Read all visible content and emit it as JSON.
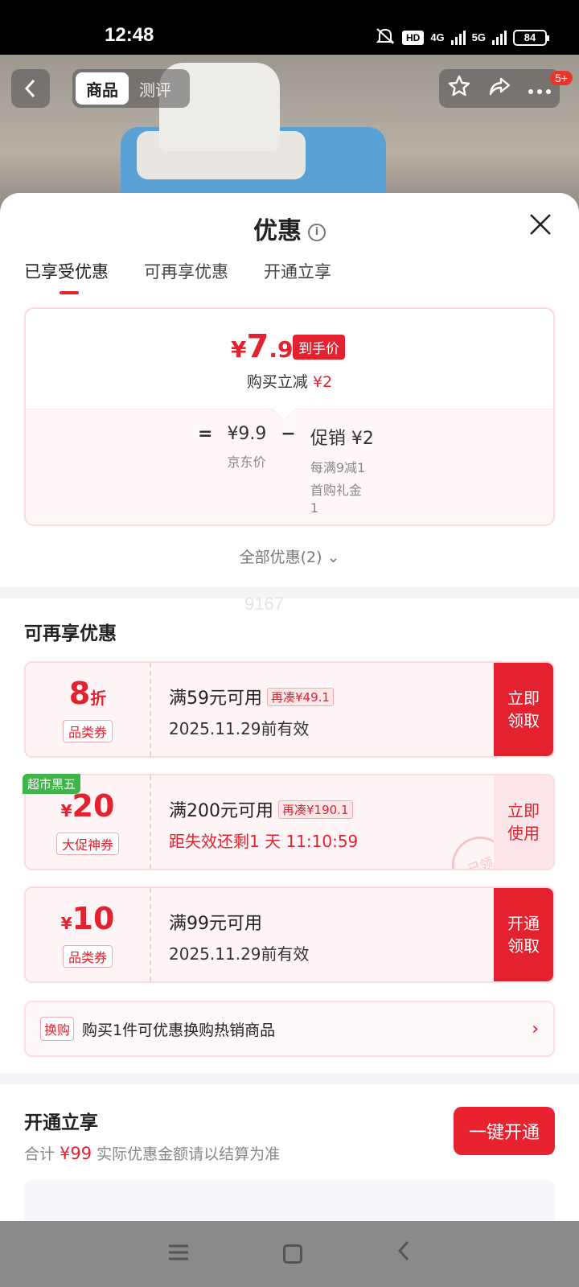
{
  "status_bar": {
    "time": "12:48",
    "net1": "4G",
    "net2": "5G",
    "hd": "HD",
    "battery": "84"
  },
  "header": {
    "tabs": [
      "商品",
      "测评"
    ],
    "badge": "5+"
  },
  "sheet": {
    "title": "优惠",
    "tabs": [
      "已享受优惠",
      "可再享优惠",
      "开通立享"
    ],
    "price_card": {
      "currency": "¥",
      "final_int": "7",
      "final_dec": ".9",
      "arrive_label": "到手价",
      "reduce_label": "购买立减",
      "reduce_value": "¥2",
      "eq": "=",
      "jd_price": "¥9.9",
      "jd_label": "京东价",
      "minus": "−",
      "promo": "促销 ¥2",
      "promo_sub1": "每满9减1",
      "promo_sub2": "首购礼金",
      "promo_sub3": "1"
    },
    "all_discounts": "全部优惠(2) ⌄",
    "watermark": "9167",
    "more_title": "可再享优惠",
    "coupons": [
      {
        "value": "8",
        "unit": "折",
        "currency": "",
        "type": "品类券",
        "cond": "满59元可用",
        "extra": "再凑¥49.1",
        "sub": "2025.11.29前有效",
        "action_l1": "立即",
        "action_l2": "领取"
      },
      {
        "value": "20",
        "unit": "",
        "currency": "¥",
        "type": "大促神券",
        "cond": "满200元可用",
        "extra": "再凑¥190.1",
        "sub": "距失效还剩1 天 11:10:59",
        "action_l1": "立即",
        "action_l2": "使用",
        "tag": "超市黑五",
        "stamp": "已领"
      },
      {
        "value": "10",
        "unit": "",
        "currency": "¥",
        "type": "品类券",
        "cond": "满99元可用",
        "extra": "",
        "sub": "2025.11.29前有效",
        "action_l1": "开通",
        "action_l2": "领取"
      }
    ],
    "exchange": {
      "tag": "换购",
      "text": "购买1件可优惠换购热销商品",
      "arrow": "›"
    },
    "open_title": "开通立享",
    "total_prefix": "合计",
    "total_value": "¥99",
    "total_suffix": "实际优惠金额请以结算为准",
    "open_button": "一键开通"
  },
  "icons": [
    "back-icon",
    "star-icon",
    "share-icon",
    "more-icon",
    "info-icon",
    "close-icon",
    "chevron-right-icon",
    "menu-icon",
    "home-icon",
    "nav-back-icon"
  ]
}
